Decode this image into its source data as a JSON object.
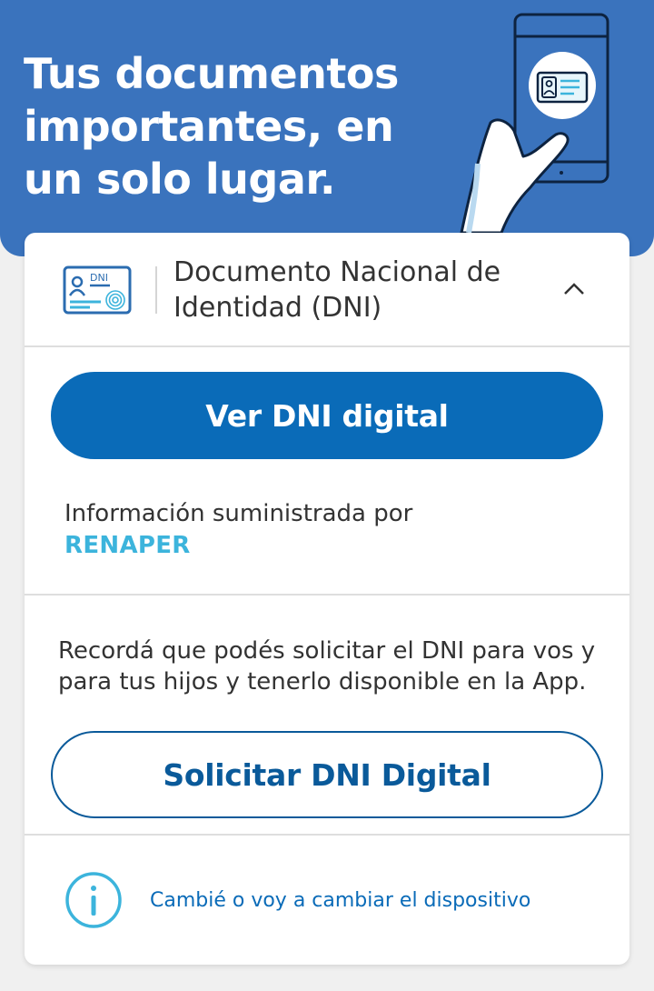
{
  "hero": {
    "title": "Tus documentos importantes, en un solo lugar."
  },
  "document": {
    "title": "Documento Nacional de Identidad (DNI)",
    "icon_label": "DNI"
  },
  "actions": {
    "view_dni_label": "Ver DNI digital",
    "request_dni_label": "Solicitar DNI Digital"
  },
  "info": {
    "supplied_by": "Información suministrada por",
    "provider": "RENAPER"
  },
  "reminder": {
    "text": "Recordá que podés solicitar el DNI para vos y para tus hijos y tenerlo disponible en la App."
  },
  "device": {
    "link_label": "Cambié o voy a cambiar el dispositivo"
  },
  "icons": [
    "dni-card-icon",
    "chevron-up-icon",
    "info-icon",
    "phone-hand-illustration"
  ],
  "colors": {
    "hero_bg": "#3a73bd",
    "primary": "#0a6bb8",
    "provider": "#3cb4dc",
    "text": "#333333"
  }
}
